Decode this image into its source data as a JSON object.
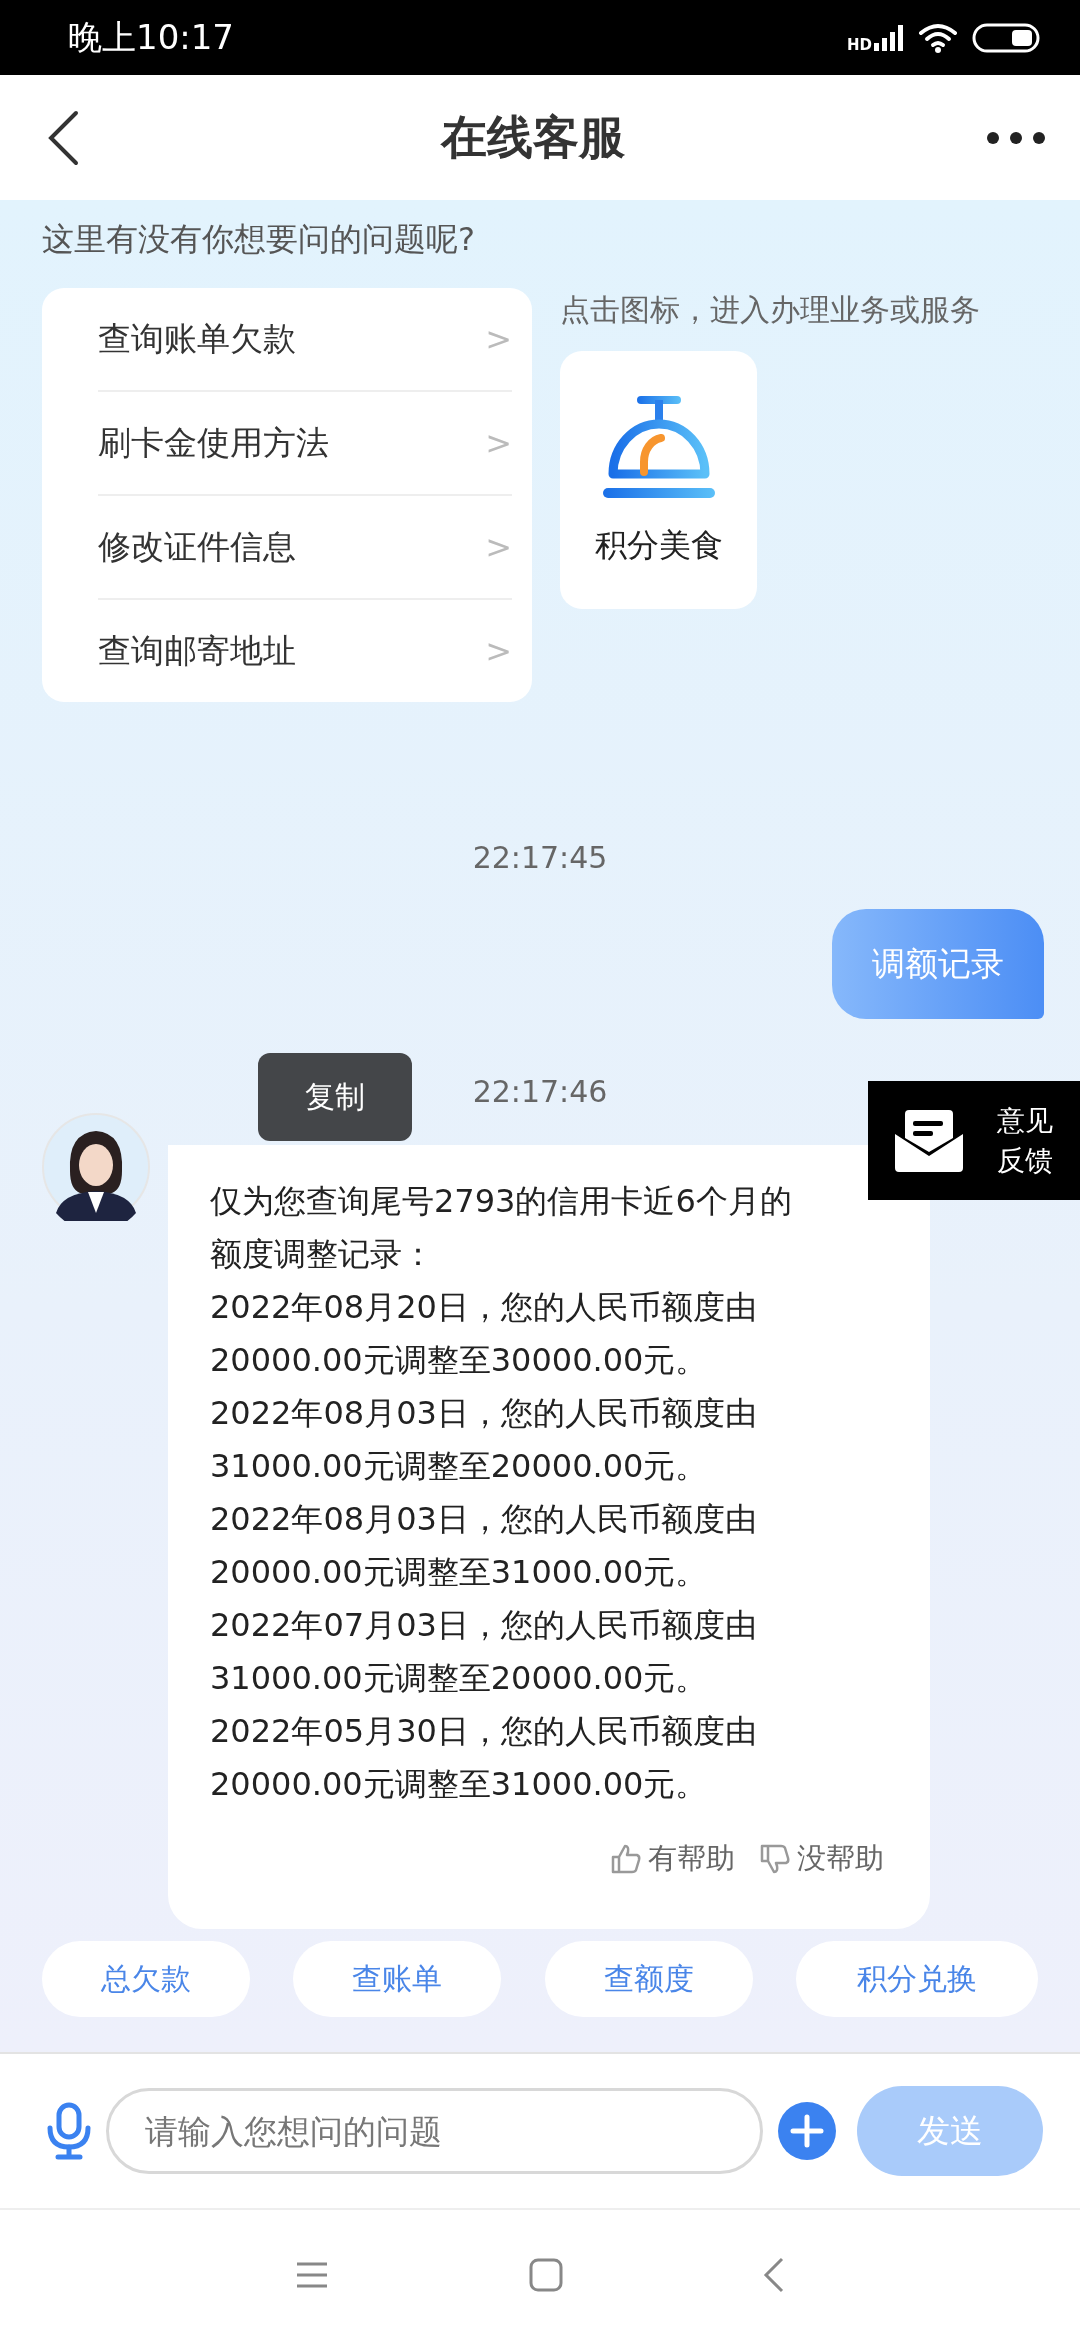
{
  "status_bar": {
    "time": "晚上10:17",
    "network": "HD"
  },
  "header": {
    "title": "在线客服"
  },
  "faq": {
    "prompt": "这里有没有你想要问的问题呢?",
    "questions": [
      "查询账单欠款",
      "刷卡金使用方法",
      "修改证件信息",
      "查询邮寄地址"
    ],
    "chevron": ">",
    "hint": "点击图标，进入办理业务或服务",
    "services": [
      {
        "label": "积分美食"
      }
    ]
  },
  "messages": [
    {
      "kind": "time",
      "text": "22:17:45"
    },
    {
      "kind": "user",
      "text": "调额记录"
    },
    {
      "kind": "time",
      "text": "22:17:46",
      "tooltip": "复制"
    },
    {
      "kind": "bot",
      "paragraphs": [
        "仅为您查询尾号2793的信用卡近6个月的额度调整记录：",
        "2022年08月20日，您的人民币额度由20000.00元调整至30000.00元。",
        "2022年08月03日，您的人民币额度由31000.00元调整至20000.00元。",
        "2022年08月03日，您的人民币额度由20000.00元调整至31000.00元。",
        "2022年07月03日，您的人民币额度由31000.00元调整至20000.00元。",
        "2022年05月30日，您的人民币额度由20000.00元调整至31000.00元。"
      ],
      "helpful": "有帮助",
      "unhelpful": "没帮助"
    }
  ],
  "feedback_tab": {
    "label": "意见反馈"
  },
  "quick_replies": [
    "总欠款",
    "查账单",
    "查额度",
    "积分兑换"
  ],
  "input": {
    "placeholder": "请输入您想问的问题",
    "send": "发送"
  }
}
